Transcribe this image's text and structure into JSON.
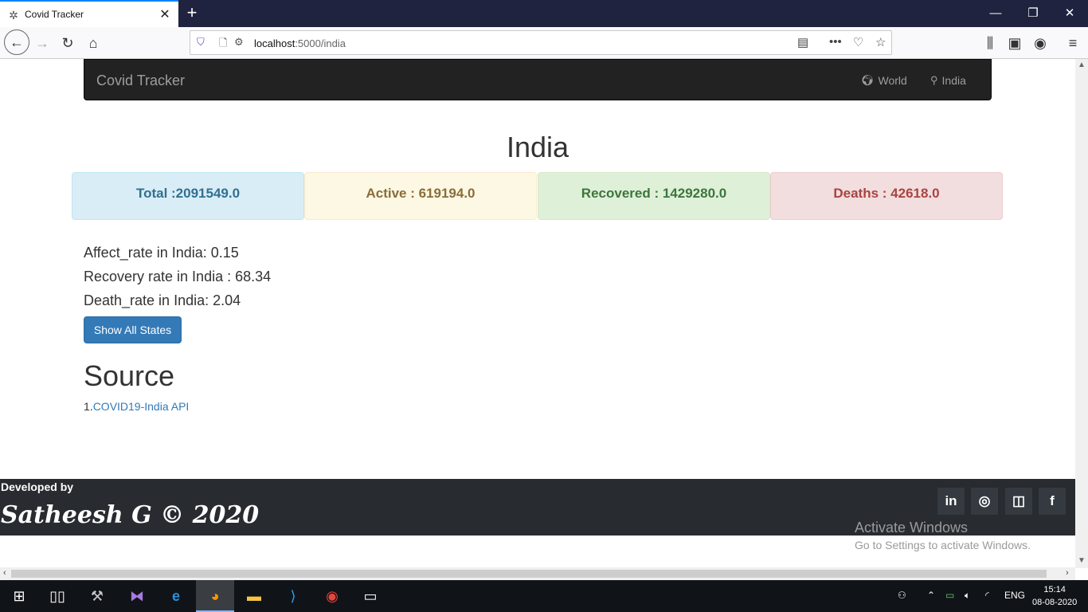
{
  "browser": {
    "tab_title": "Covid Tracker",
    "url_host": "localhost",
    "url_path": ":5000/india"
  },
  "navbar": {
    "brand": "Covid Tracker",
    "links": [
      {
        "label": "World",
        "icon": "globe-icon"
      },
      {
        "label": "India",
        "icon": "map-marker-icon"
      }
    ]
  },
  "main": {
    "title": "India",
    "stats": {
      "total": "Total :2091549.0",
      "active": "Active : 619194.0",
      "recovered": "Recovered : 1429280.0",
      "deaths": "Deaths : 42618.0"
    },
    "rates": [
      "Affect_rate in India: 0.15",
      "Recovery rate in India : 68.34",
      "Death_rate in India: 2.04"
    ],
    "show_states_button": "Show All States",
    "source_heading": "Source",
    "source_prefix": "1.",
    "source_link": "COVID19-India API"
  },
  "footer": {
    "developed_by": "Developed by",
    "developer": "Satheesh G © 2020",
    "social": [
      "linkedin-icon",
      "github-icon",
      "instagram-icon",
      "facebook-icon"
    ]
  },
  "watermark": {
    "line1": "Activate Windows",
    "line2": "Go to Settings to activate Windows."
  },
  "taskbar": {
    "language": "ENG",
    "time": "15:14",
    "date": "08-08-2020"
  }
}
